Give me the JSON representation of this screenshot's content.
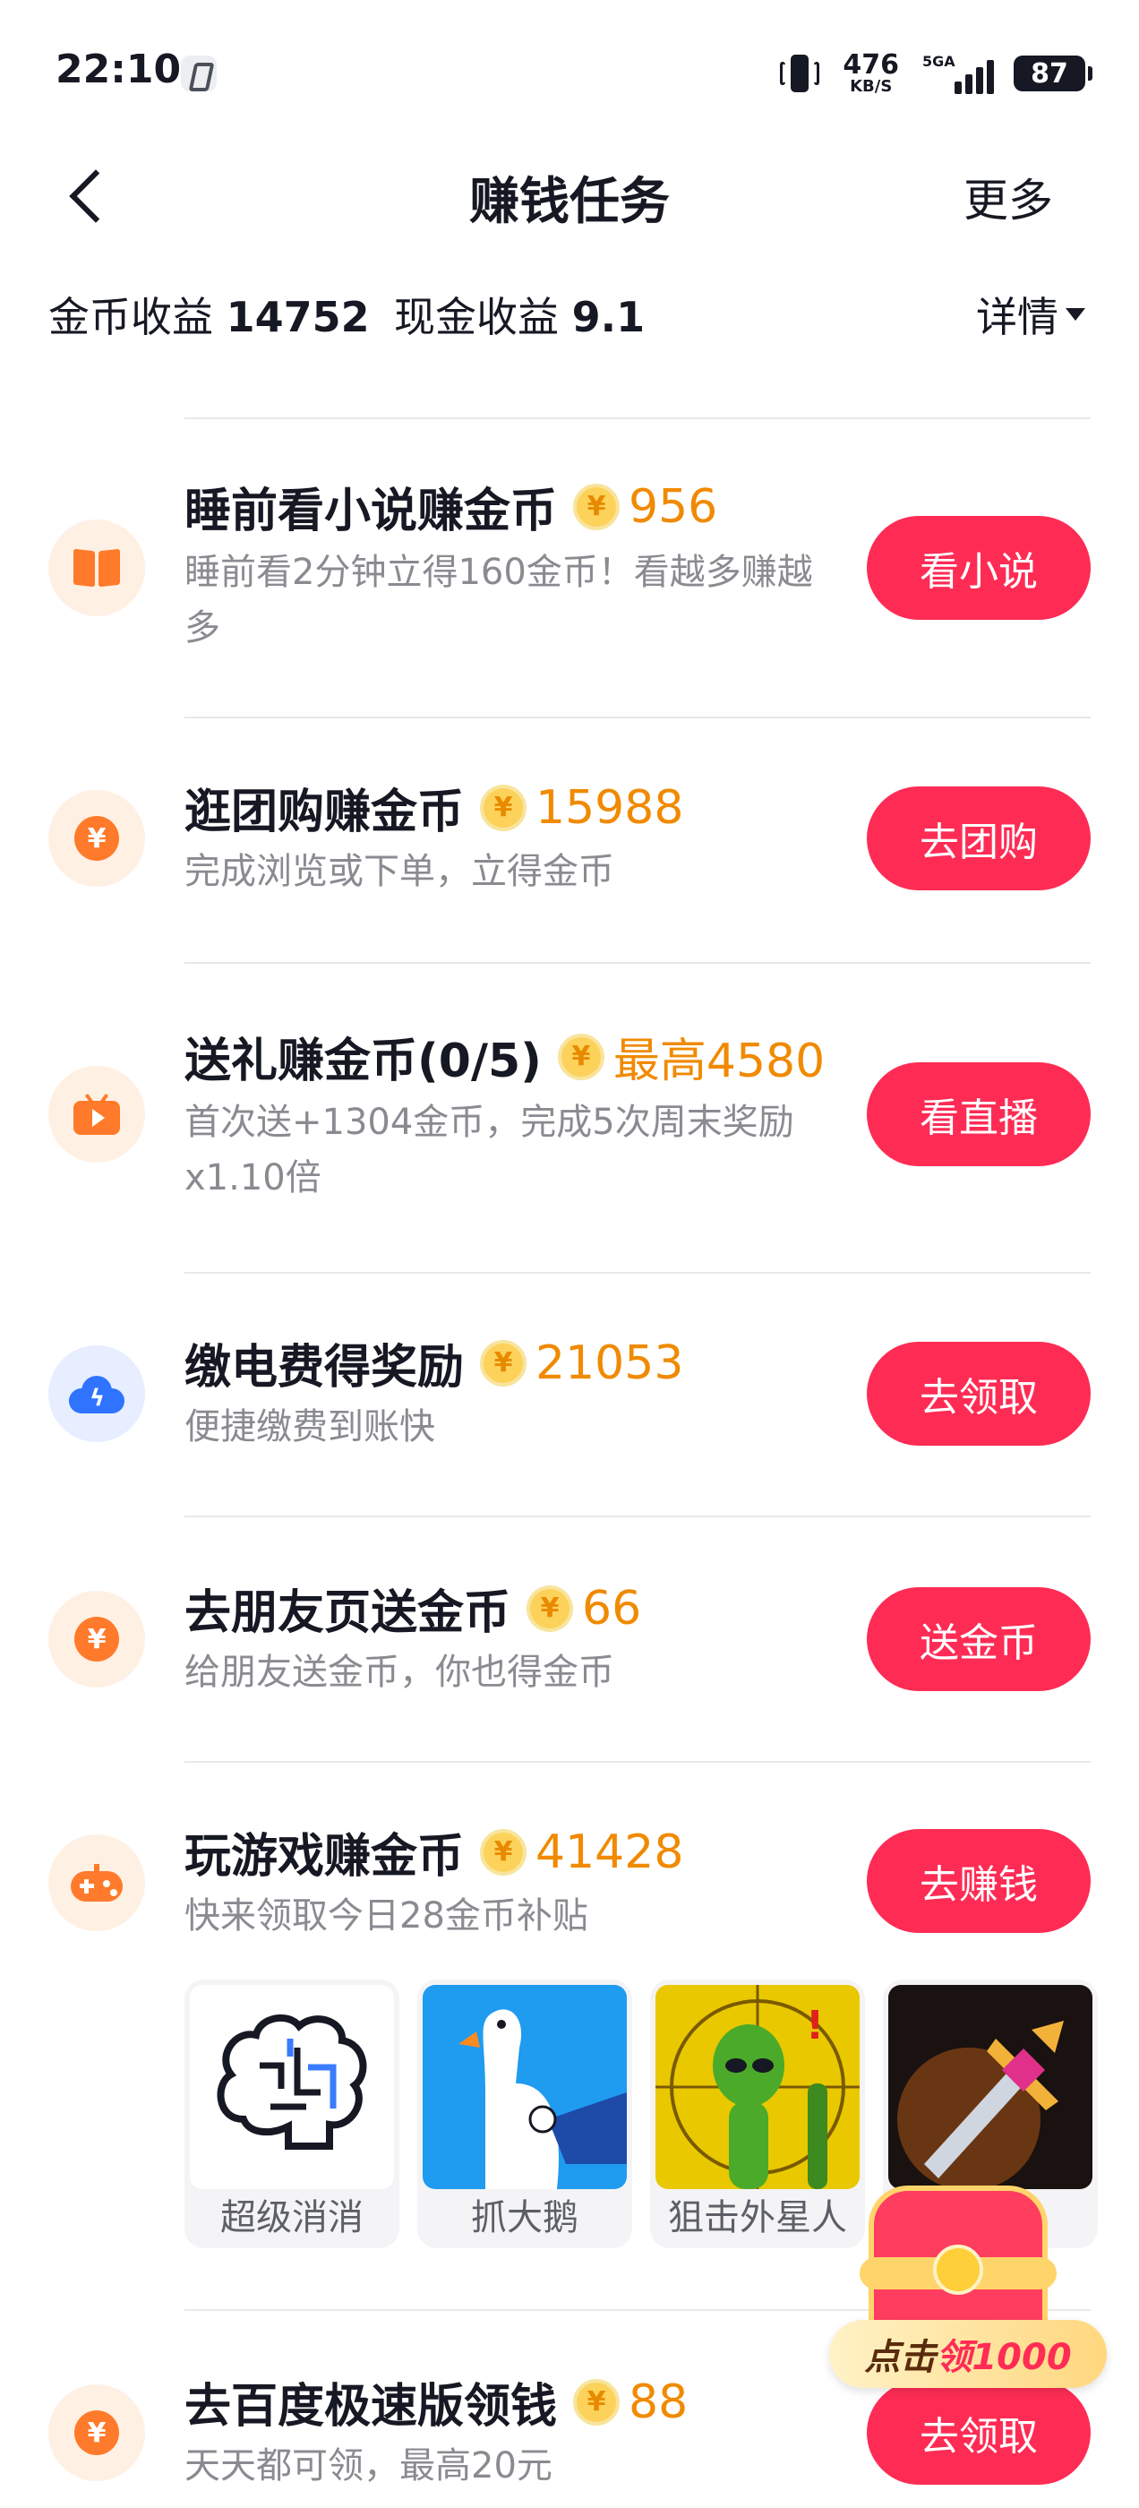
{
  "status_bar": {
    "time": "22:10",
    "net_speed_value": "476",
    "net_speed_unit": "KB/S",
    "signal_label": "5GA",
    "battery": "87"
  },
  "nav": {
    "title": "赚钱任务",
    "more": "更多"
  },
  "summary": {
    "coin_label": "金币收益",
    "coin_value": "14752",
    "cash_label": "现金收益",
    "cash_value": "9.1",
    "detail": "详情"
  },
  "coin_symbol": "¥",
  "tasks": [
    {
      "icon": "book-icon",
      "title": "睡前看小说赚金币",
      "reward": "956",
      "desc": "睡前看2分钟立得160金币！看越多赚越多",
      "button": "看小说"
    },
    {
      "icon": "yuan-icon",
      "title": "逛团购赚金币",
      "reward": "15988",
      "desc": "完成浏览或下单，立得金币",
      "button": "去团购"
    },
    {
      "icon": "tv-icon",
      "title": "送礼赚金币(0/5)",
      "reward": "最高4580",
      "desc": "首次送+1304金币，完成5次周末奖励x1.10倍",
      "button": "看直播"
    },
    {
      "icon": "cloud-bolt-icon",
      "title": "缴电费得奖励",
      "reward": "21053",
      "desc": "便捷缴费到账快",
      "button": "去领取"
    },
    {
      "icon": "yuan-icon",
      "title": "去朋友页送金币",
      "reward": "66",
      "desc": "给朋友送金币，你也得金币",
      "button": "送金币"
    },
    {
      "icon": "gamepad-icon",
      "title": "玩游戏赚金币",
      "reward": "41428",
      "desc": "快来领取今日28金币补贴",
      "button": "去赚钱"
    },
    {
      "icon": "yuan-icon",
      "title": "去百度极速版领钱",
      "reward": "88",
      "desc": "天天都可领，最高20元",
      "button": "去领取"
    }
  ],
  "games": [
    {
      "name": "超级消消"
    },
    {
      "name": "抓大鹅"
    },
    {
      "name": "狙击外星人"
    },
    {
      "name": ""
    }
  ],
  "chest": {
    "prefix": "点击",
    "highlight": "领1000"
  },
  "colors": {
    "accent": "#fe2c55",
    "reward": "#f08a00",
    "icon_orange": "#ff7a2a",
    "icon_blue": "#2f73ff"
  }
}
